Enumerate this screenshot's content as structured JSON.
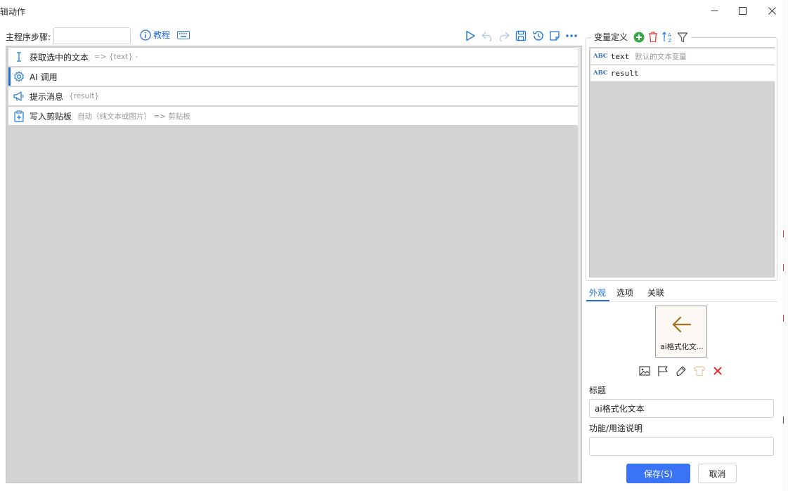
{
  "window": {
    "title": "编辑动作"
  },
  "toolbar": {
    "main_steps_label": "主程序步骤:",
    "step_input_value": "",
    "tutorial_label": "教程"
  },
  "steps": [
    {
      "label": "获取选中的文本",
      "extra": "=> {text} -",
      "icon": "text-cursor-icon"
    },
    {
      "label": "AI 调用",
      "extra": "",
      "icon": "gear-icon"
    },
    {
      "label": "提示消息",
      "extra": "{result}",
      "icon": "megaphone-icon"
    },
    {
      "label": "写入剪贴板",
      "extra": "自动（纯文本或图片） => 剪贴板",
      "icon": "clipboard-icon"
    }
  ],
  "variables": {
    "header": "变量定义",
    "items": [
      {
        "type": "ABC",
        "name": "text",
        "desc": "默认的文本变量"
      },
      {
        "type": "ABC",
        "name": "result",
        "desc": ""
      }
    ]
  },
  "tabs": [
    {
      "label": "外观",
      "active": true
    },
    {
      "label": "选项",
      "active": false
    },
    {
      "label": "关联",
      "active": false
    }
  ],
  "appearance": {
    "preview_caption": "ai格式化文...",
    "icon": "arrow-left-icon",
    "icon_color": "#a8701e"
  },
  "form": {
    "title_label": "标题",
    "title_value": "ai格式化文本",
    "desc_label": "功能/用途说明",
    "desc_value": ""
  },
  "buttons": {
    "save": "保存(S)",
    "cancel": "取消"
  },
  "colors": {
    "accent": "#1e6fd9",
    "save_button": "#3a74f5",
    "add_green": "#3aa547",
    "delete_red": "#e0443a"
  }
}
